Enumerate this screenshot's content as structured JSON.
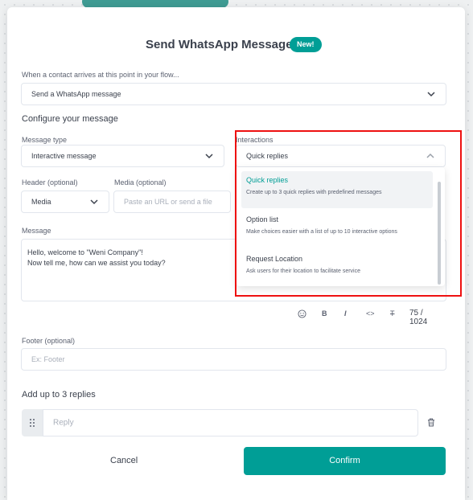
{
  "modal": {
    "title": "Send WhatsApp Message",
    "badge": "New!"
  },
  "trigger": {
    "label": "When a contact arrives at this point in your flow...",
    "value": "Send a WhatsApp message"
  },
  "configure_heading": "Configure your message",
  "message_type": {
    "label": "Message type",
    "value": "Interactive message"
  },
  "interactions": {
    "label": "Interactions",
    "value": "Quick replies",
    "options": [
      {
        "title": "Quick replies",
        "description": "Create up to 3 quick replies with predefined messages"
      },
      {
        "title": "Option list",
        "description": "Make choices easier with a list of up to 10 interactive options"
      },
      {
        "title": "Request Location",
        "description": "Ask users for their location to facilitate service"
      }
    ]
  },
  "header": {
    "label": "Header (optional)",
    "value": "Media"
  },
  "media": {
    "label": "Media (optional)",
    "placeholder": "Paste an URL or send a file"
  },
  "message": {
    "label": "Message",
    "line1": "Hello, welcome to \"Weni Company\"!",
    "line2": "Now tell me, how can we assist you today?",
    "counter": "75 / 1024"
  },
  "toolbar": {
    "bold": "B",
    "italic": "I",
    "code": "<>",
    "strike": "T"
  },
  "footer": {
    "label": "Footer (optional)",
    "placeholder": "Ex: Footer"
  },
  "replies": {
    "heading": "Add up to 3 replies",
    "placeholder": "Reply"
  },
  "actions": {
    "cancel": "Cancel",
    "confirm": "Confirm"
  },
  "colors": {
    "accent": "#009e96",
    "highlight": "#ee1111"
  },
  "icons": [
    "chevron-down-icon",
    "chevron-up-icon",
    "emoji-icon",
    "drag-handle-icon",
    "trash-icon"
  ]
}
